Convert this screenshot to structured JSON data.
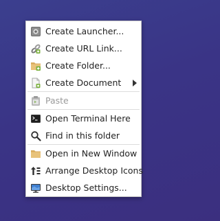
{
  "menu": {
    "items": [
      {
        "label": "Create Launcher...",
        "icon": "launcher-icon"
      },
      {
        "label": "Create URL Link...",
        "icon": "link-icon"
      },
      {
        "label": "Create Folder...",
        "icon": "folder-new-icon"
      },
      {
        "label": "Create Document",
        "icon": "document-icon"
      },
      {
        "label": "Paste",
        "icon": "paste-icon"
      },
      {
        "label": "Open Terminal Here",
        "icon": "terminal-icon"
      },
      {
        "label": "Find in this folder",
        "icon": "search-icon"
      },
      {
        "label": "Open in New Window",
        "icon": "folder-icon"
      },
      {
        "label": "Arrange Desktop Icons",
        "icon": "arrange-icon"
      },
      {
        "label": "Desktop Settings...",
        "icon": "monitor-icon"
      }
    ]
  },
  "colors": {
    "desktop_background": "#3a3486",
    "menu_background": "#ffffff",
    "disabled_text": "#9a9a9a",
    "folder": "#e8c27a"
  }
}
